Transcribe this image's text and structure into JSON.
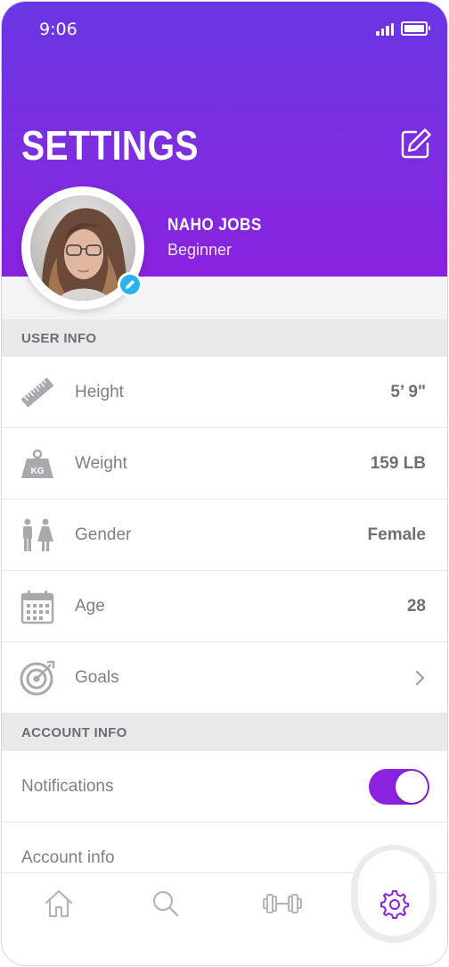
{
  "status_bar": {
    "time": "9:06"
  },
  "header": {
    "title": "SETTINGS"
  },
  "profile": {
    "name": "NAHO JOBS",
    "level": "Beginner"
  },
  "sections": {
    "user_info": "USER INFO",
    "account_info": "ACCOUNT INFO"
  },
  "user_info_rows": [
    {
      "icon": "ruler-icon",
      "label": "Height",
      "value": "5’ 9\""
    },
    {
      "icon": "weight-icon",
      "label": "Weight",
      "value": "159 LB",
      "icon_text": "KG"
    },
    {
      "icon": "gender-icon",
      "label": "Gender",
      "value": "Female"
    },
    {
      "icon": "calendar-icon",
      "label": "Age",
      "value": "28"
    },
    {
      "icon": "target-icon",
      "label": "Goals",
      "value": ""
    }
  ],
  "account_rows": [
    {
      "label": "Notifications",
      "toggle_on": true
    },
    {
      "label": "Account info"
    }
  ],
  "tabbar": {
    "items": [
      "home-icon",
      "search-icon",
      "dumbbell-icon",
      "gear-icon"
    ],
    "active": "gear-icon"
  },
  "colors": {
    "accent": "#8a22df",
    "header_top": "#6a36e4",
    "edit_badge": "#28b4ec"
  }
}
